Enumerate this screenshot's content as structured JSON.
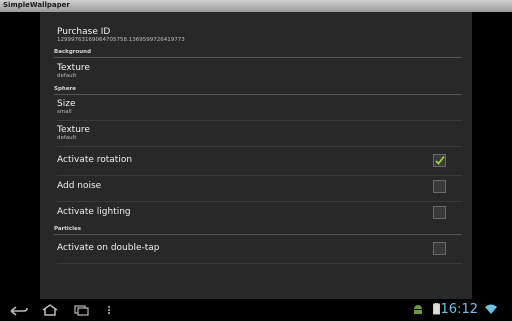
{
  "app": {
    "title": "SimpleWallpaper"
  },
  "preferences": {
    "purchase": {
      "title": "Purchase ID",
      "summary": "12999763169064705758.1369599726419773"
    },
    "background": {
      "header": "Background",
      "texture": {
        "title": "Texture",
        "summary": "default"
      }
    },
    "sphere": {
      "header": "Sphere",
      "size": {
        "title": "Size",
        "summary": "small"
      },
      "texture": {
        "title": "Texture",
        "summary": "default"
      },
      "rotation": {
        "title": "Activate rotation",
        "checked": true
      },
      "noise": {
        "title": "Add noise",
        "checked": false
      },
      "lighting": {
        "title": "Activate lighting",
        "checked": false
      }
    },
    "particles": {
      "header": "Particles",
      "double_tap": {
        "title": "Activate on double-tap",
        "checked": false
      }
    }
  },
  "status_bar": {
    "time": "16:12"
  },
  "icons": {
    "back": "back-arrow-icon",
    "home": "home-icon",
    "recents": "recent-apps-icon",
    "menu": "overflow-menu-icon",
    "android": "android-debug-icon",
    "battery": "battery-icon",
    "wifi": "wifi-icon"
  },
  "colors": {
    "accent": "#6ec1e4",
    "check": "#9acd32"
  }
}
